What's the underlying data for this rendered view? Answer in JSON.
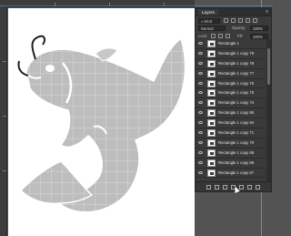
{
  "panel": {
    "tab": "Layers",
    "menu_icon": "panel-menu-icon",
    "filter": {
      "kind_label": "Kind"
    },
    "blend": {
      "mode": "Normal",
      "opacity_label": "Opacity:",
      "opacity_value": "100%"
    },
    "lock": {
      "label": "Lock:",
      "fill_label": "Fill:",
      "fill_value": "100%"
    }
  },
  "layers": [
    "Rectangle 1",
    "Rectangle 1 copy 79",
    "Rectangle 1 copy 78",
    "Rectangle 1 copy 77",
    "Rectangle 1 copy 76",
    "Rectangle 1 copy 75",
    "Rectangle 1 copy 74",
    "Rectangle 1 copy 85",
    "Rectangle 1 copy 84",
    "Rectangle 1 copy 71",
    "Rectangle 1 copy 70",
    "Rectangle 1 copy 69",
    "Rectangle 1 copy 68",
    "Rectangle 1 copy 67"
  ],
  "footer_icons": [
    "link-icon",
    "fx-icon",
    "mask-icon",
    "adjustment-icon",
    "folder-icon",
    "new-layer-icon",
    "trash-icon"
  ],
  "colors": {
    "guide": "#1bb3c9",
    "fish": "#bdbdbd",
    "workspace": "#535353"
  }
}
